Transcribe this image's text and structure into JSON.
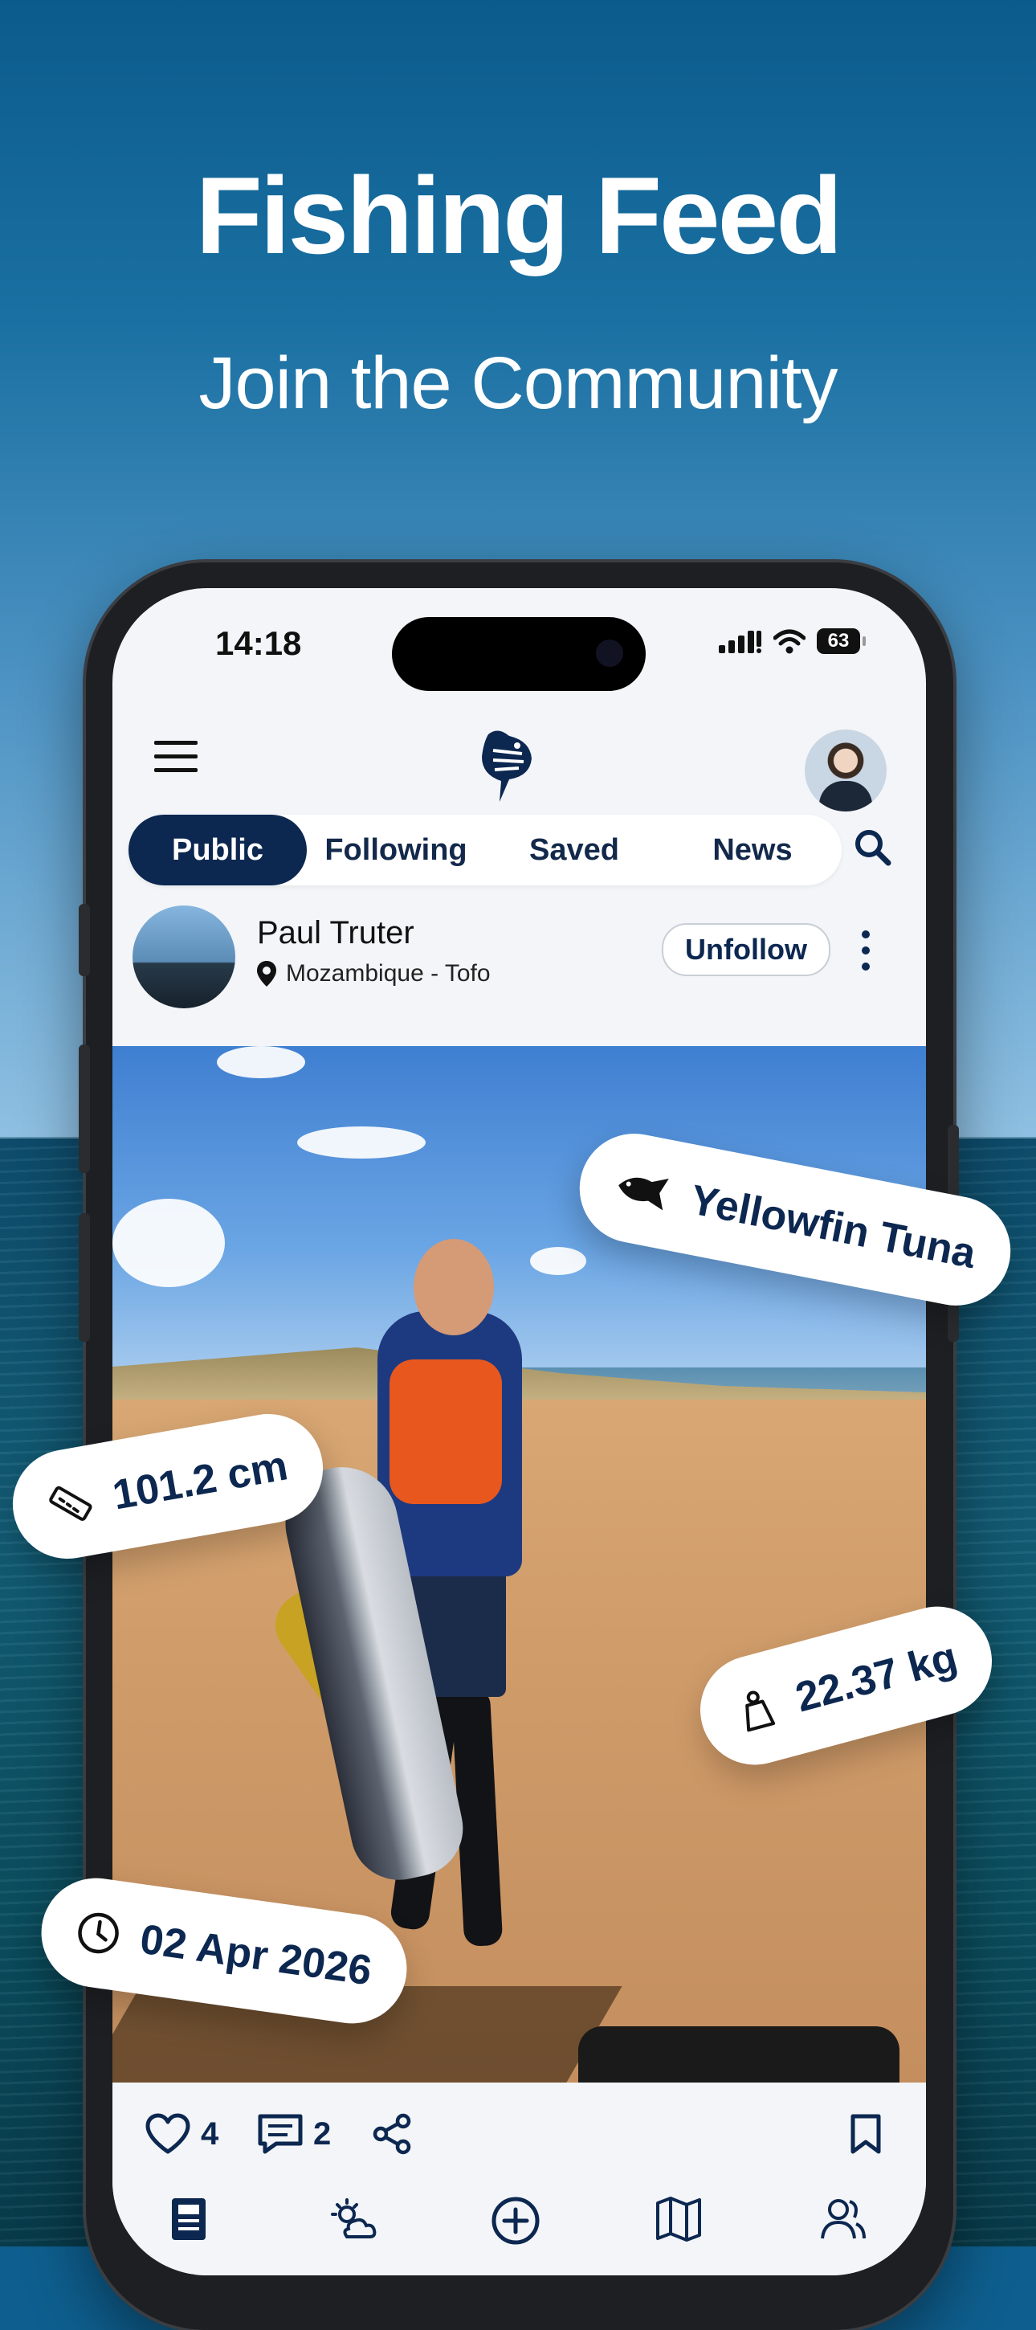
{
  "hero": {
    "title": "Fishing Feed",
    "subtitle": "Join the Community"
  },
  "status_bar": {
    "time": "14:18",
    "battery": "63"
  },
  "tabs": [
    {
      "label": "Public",
      "active": true
    },
    {
      "label": "Following",
      "active": false
    },
    {
      "label": "Saved",
      "active": false
    },
    {
      "label": "News",
      "active": false
    }
  ],
  "post": {
    "author": "Paul Truter",
    "location": "Mozambique - Tofo",
    "follow_button": "Unfollow",
    "likes": "4",
    "comments": "2"
  },
  "catch_tags": {
    "species": "Yellowfin Tuna",
    "length": "101.2 cm",
    "weight": "22.37 kg",
    "date": "02 Apr 2026"
  },
  "colors": {
    "brand_navy": "#0c2750",
    "background": "#f3f5f8"
  },
  "icons": [
    "menu-icon",
    "fish-logo-icon",
    "search-icon",
    "location-pin-icon",
    "more-vertical-icon",
    "heart-icon",
    "comment-icon",
    "share-icon",
    "bookmark-icon",
    "fish-icon",
    "ruler-icon",
    "weight-icon",
    "clock-icon",
    "feed-icon",
    "weather-icon",
    "add-icon",
    "map-icon",
    "community-icon"
  ]
}
